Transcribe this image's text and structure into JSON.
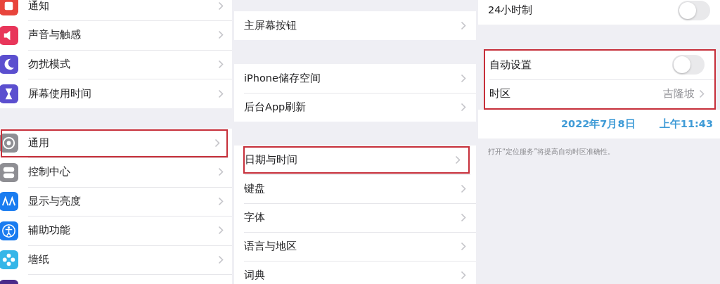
{
  "panels": [
    {
      "groups": [
        {
          "items": [
            {
              "kind": "link",
              "label": "通知",
              "color": "#e8453c",
              "highlighted": false
            },
            {
              "kind": "link",
              "label": "声音与触感",
              "color": "#e8365a",
              "highlighted": false
            },
            {
              "kind": "link",
              "label": "勿扰模式",
              "color": "#5b4fcf",
              "highlighted": false
            },
            {
              "kind": "link",
              "label": "屏幕使用时间",
              "color": "#5b4fcf",
              "highlighted": false
            }
          ]
        },
        {
          "items": [
            {
              "kind": "link",
              "label": "通用",
              "color": "#8e8e93",
              "highlighted": true
            },
            {
              "kind": "link",
              "label": "控制中心",
              "color": "#8e8e93",
              "highlighted": false
            },
            {
              "kind": "link",
              "label": "显示与亮度",
              "color": "#1a7cf0",
              "highlighted": false
            },
            {
              "kind": "link",
              "label": "辅助功能",
              "color": "#1a7cf0",
              "highlighted": false
            },
            {
              "kind": "link",
              "label": "墙纸",
              "color": "#35b6e8",
              "highlighted": false
            },
            {
              "kind": "link",
              "color": "#4a2a8a",
              "highlighted": false
            }
          ]
        }
      ]
    },
    {
      "groups": [
        {
          "items": [
            {
              "kind": "link",
              "label": "主屏幕按钮",
              "highlighted": false
            }
          ]
        },
        {
          "items": [
            {
              "kind": "link",
              "label": "iPhone储存空间",
              "highlighted": false
            },
            {
              "kind": "link",
              "label": "后台App刷新",
              "highlighted": false
            }
          ]
        },
        {
          "items": [
            {
              "kind": "link",
              "label": "日期与时间",
              "highlighted": true
            },
            {
              "kind": "link",
              "label": "键盘",
              "highlighted": false
            },
            {
              "kind": "link",
              "label": "字体",
              "highlighted": false
            },
            {
              "kind": "link",
              "label": "语言与地区",
              "highlighted": false
            },
            {
              "kind": "link",
              "label": "词典",
              "highlighted": false
            }
          ]
        }
      ]
    },
    {
      "groups": [
        {
          "items": [
            {
              "kind": "toggle",
              "label": "24小时制",
              "on": false,
              "highlighted": false
            }
          ]
        },
        {
          "highlighted": true,
          "items": [
            {
              "kind": "toggle",
              "label": "自动设置",
              "on": false,
              "highlighted": false
            },
            {
              "kind": "value",
              "label": "时区",
              "value": "吉隆坡",
              "highlighted": false
            }
          ]
        },
        {
          "items": [
            {
              "kind": "datetime",
              "date": "2022年7月8日",
              "time": "上午11:43",
              "highlighted": false
            }
          ],
          "footer": "打开“定位服务”将提高自动时区准确性。"
        }
      ]
    }
  ]
}
